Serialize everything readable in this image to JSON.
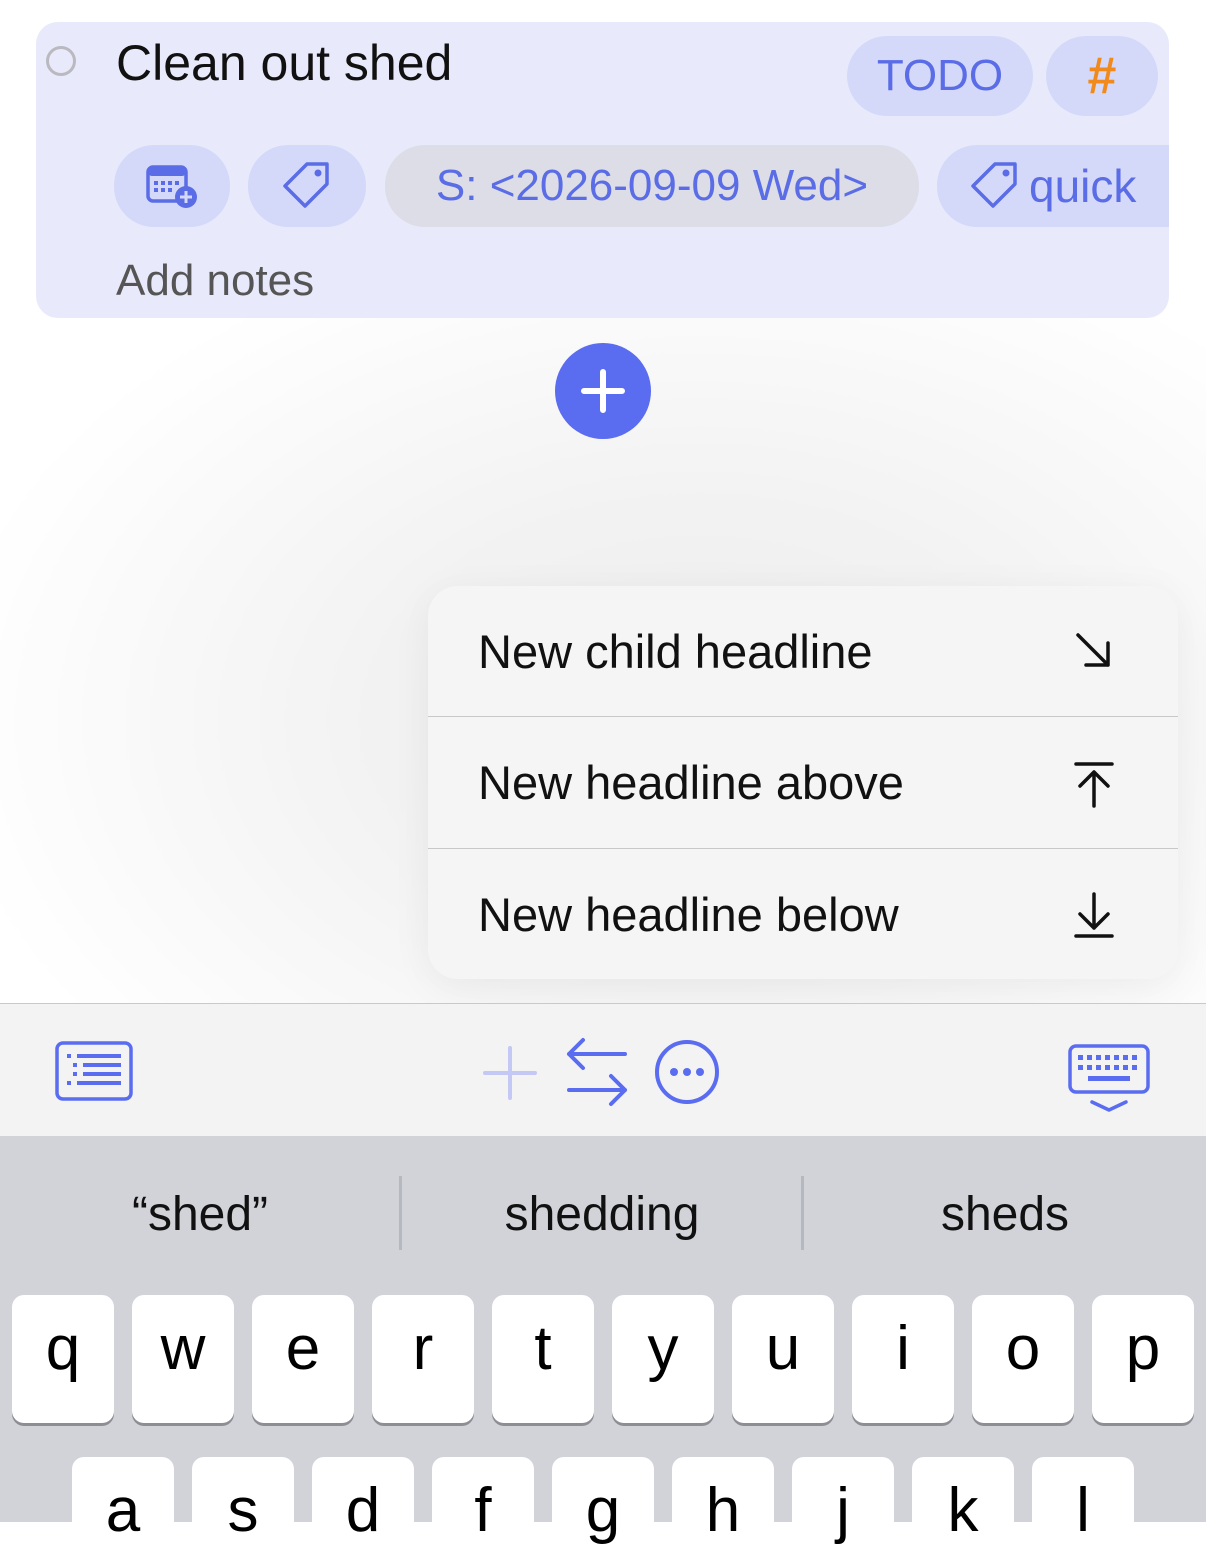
{
  "task": {
    "title": "Clean out shed",
    "status": "TODO",
    "hash_label": "#",
    "scheduled": "S: <2026-09-09 Wed>",
    "tag": "quick",
    "notes_placeholder": "Add notes"
  },
  "menu": {
    "items": [
      {
        "label": "New child headline",
        "icon": "arrow-down-right-icon"
      },
      {
        "label": "New headline above",
        "icon": "arrow-up-to-line-icon"
      },
      {
        "label": "New headline below",
        "icon": "arrow-down-to-line-icon"
      }
    ]
  },
  "suggestions": [
    "“shed”",
    "shedding",
    "sheds"
  ],
  "keyboard": {
    "row1": [
      "q",
      "w",
      "e",
      "r",
      "t",
      "y",
      "u",
      "i",
      "o",
      "p"
    ],
    "row2": [
      "a",
      "s",
      "d",
      "f",
      "g",
      "h",
      "j",
      "k",
      "l"
    ]
  },
  "colors": {
    "accent": "#5a6cf0",
    "card_bg": "#e8eafc",
    "pill_bg": "#d5d9f9",
    "hash": "#f08a1c"
  }
}
